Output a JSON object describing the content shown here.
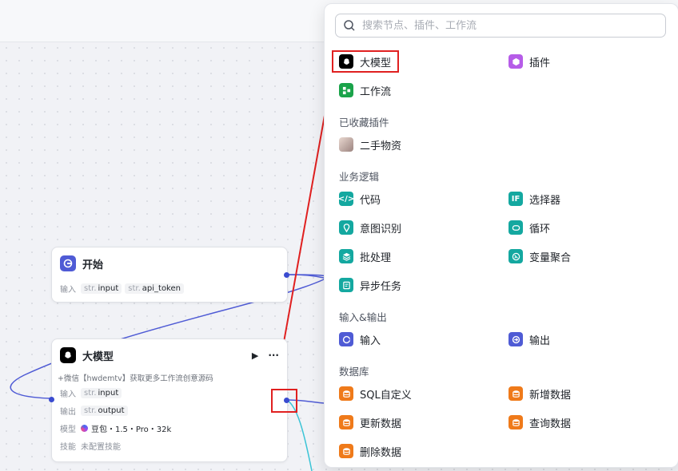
{
  "canvas": {
    "start_node": {
      "title": "开始",
      "input_label": "输入",
      "params": [
        {
          "type": "str.",
          "name": "input"
        },
        {
          "type": "str.",
          "name": "api_token"
        }
      ]
    },
    "llm_node": {
      "title": "大模型",
      "description": "+微信【hwdemtv】获取更多工作流创意源码",
      "input_label": "输入",
      "input_param": {
        "type": "str.",
        "name": "input"
      },
      "output_label": "输出",
      "output_param": {
        "type": "str.",
        "name": "output"
      },
      "model_label": "模型",
      "model_value": "豆包・1.5・Pro・32k",
      "skill_label": "技能",
      "skill_value": "未配置技能",
      "run_glyph": "▶",
      "more_glyph": "···"
    }
  },
  "panel": {
    "search": {
      "placeholder": "搜索节点、插件、工作流"
    },
    "top_items": [
      {
        "label": "大模型",
        "icon": "llm-icon",
        "color": "#000000"
      },
      {
        "label": "插件",
        "icon": "plugin-icon",
        "color": "#b65ce8"
      },
      {
        "label": "工作流",
        "icon": "workflow-icon",
        "color": "#1aa34a"
      }
    ],
    "favorites": {
      "title": "已收藏插件",
      "items": [
        {
          "label": "二手物资",
          "icon": "avatar-icon"
        }
      ]
    },
    "business_logic": {
      "title": "业务逻辑",
      "items": [
        {
          "label": "代码",
          "icon": "code-icon",
          "color": "#14a8a0"
        },
        {
          "label": "选择器",
          "icon": "if-icon",
          "color": "#14a8a0"
        },
        {
          "label": "意图识别",
          "icon": "intent-icon",
          "color": "#14a8a0"
        },
        {
          "label": "循环",
          "icon": "loop-icon",
          "color": "#14a8a0"
        },
        {
          "label": "批处理",
          "icon": "batch-icon",
          "color": "#14a8a0"
        },
        {
          "label": "变量聚合",
          "icon": "aggregate-icon",
          "color": "#14a8a0"
        },
        {
          "label": "异步任务",
          "icon": "async-icon",
          "color": "#14a8a0"
        }
      ]
    },
    "io": {
      "title": "输入&输出",
      "items": [
        {
          "label": "输入",
          "icon": "input-icon",
          "color": "#4f5bd5"
        },
        {
          "label": "输出",
          "icon": "output-icon",
          "color": "#4f5bd5"
        }
      ]
    },
    "database": {
      "title": "数据库",
      "items": [
        {
          "label": "SQL自定义",
          "icon": "db-sql-icon",
          "color": "#ef7a1a"
        },
        {
          "label": "新增数据",
          "icon": "db-add-icon",
          "color": "#ef7a1a"
        },
        {
          "label": "更新数据",
          "icon": "db-update-icon",
          "color": "#ef7a1a"
        },
        {
          "label": "查询数据",
          "icon": "db-query-icon",
          "color": "#ef7a1a"
        },
        {
          "label": "删除数据",
          "icon": "db-delete-icon",
          "color": "#ef7a1a"
        }
      ]
    }
  },
  "annotation_color": "#e02020"
}
